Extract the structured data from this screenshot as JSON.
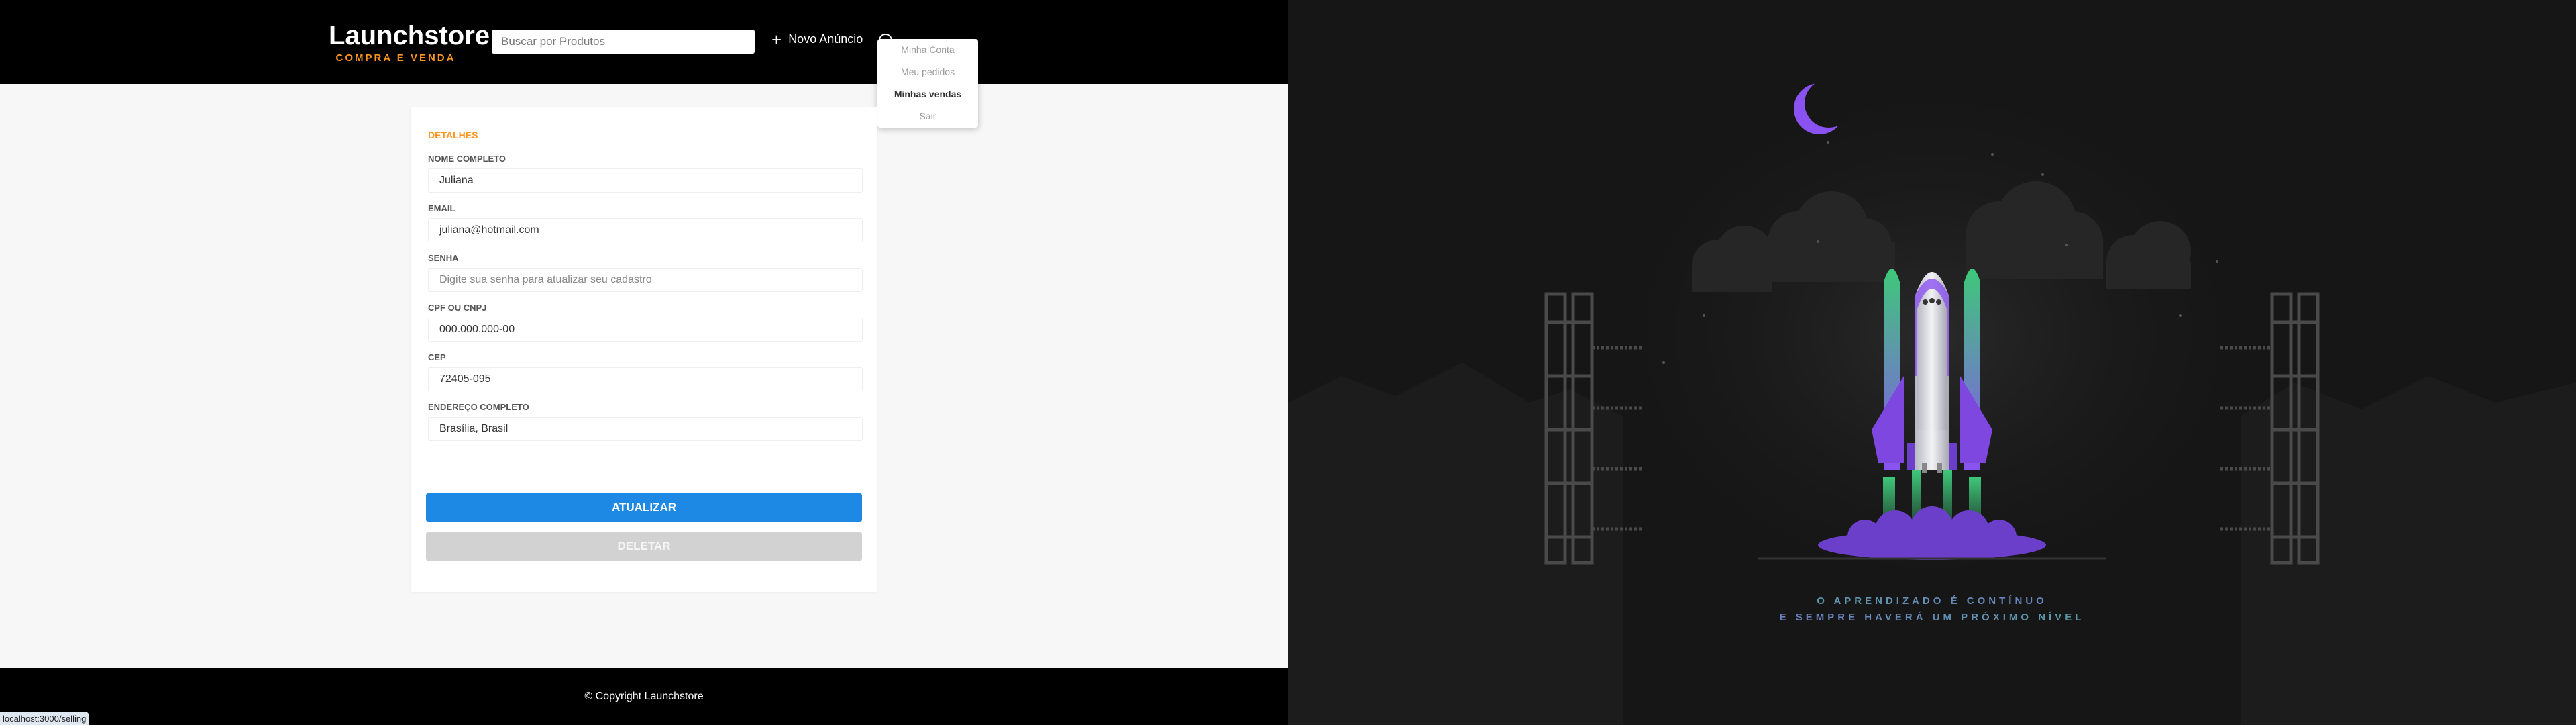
{
  "header": {
    "logo_title": "Launchstore",
    "logo_subtitle": "COMPRA E VENDA",
    "search_placeholder": "Buscar por Produtos",
    "new_ad_label": "Novo Anúncio",
    "new_ad_icon": "plus-icon",
    "account_icon": "account-circle-icon"
  },
  "dropdown": {
    "items": [
      {
        "label": "Minha Conta"
      },
      {
        "label": "Meu pedidos"
      },
      {
        "label": "Minhas vendas"
      },
      {
        "label": "Sair"
      }
    ]
  },
  "form": {
    "section_title": "DETALHES",
    "fields": [
      {
        "label": "NOME COMPLETO",
        "value": "Juliana",
        "placeholder": ""
      },
      {
        "label": "EMAIL",
        "value": "juliana@hotmail.com",
        "placeholder": ""
      },
      {
        "label": "SENHA",
        "value": "",
        "placeholder": "Digite sua senha para atualizar seu cadastro"
      },
      {
        "label": "CPF OU CNPJ",
        "value": "000.000.000-00",
        "placeholder": ""
      },
      {
        "label": "CEP",
        "value": "72405-095",
        "placeholder": ""
      },
      {
        "label": "ENDEREÇO COMPLETO",
        "value": "Brasília, Brasil",
        "placeholder": ""
      }
    ],
    "update_button": "ATUALIZAR",
    "delete_button": "DELETAR"
  },
  "footer": {
    "copyright": "© Copyright Launchstore"
  },
  "status_bar_url": "localhost:3000/selling",
  "right_panel": {
    "tagline_line1": "O APRENDIZADO É CONTÍNUO",
    "tagline_line2": "E SEMPRE HAVERÁ UM PRÓXIMO NÍVEL"
  },
  "colors": {
    "accent_orange": "#fd951f",
    "primary_blue": "#1e88e5",
    "disabled_gray": "#d2d2d2",
    "header_black": "#000000",
    "rocket_purple": "#8a52f0",
    "rocket_green": "#3ec87a"
  }
}
